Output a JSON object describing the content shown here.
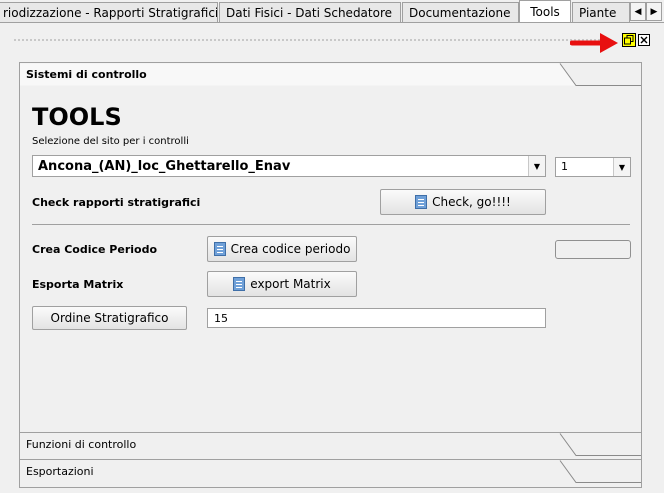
{
  "tabs": [
    {
      "label": "riodizzazione - Rapporti Stratigrafici",
      "active": false
    },
    {
      "label": "Dati Fisici - Dati Schedatore",
      "active": false
    },
    {
      "label": "Documentazione",
      "active": false
    },
    {
      "label": "Tools",
      "active": true
    },
    {
      "label": "Piante",
      "active": false
    }
  ],
  "tab_scroll": {
    "left": "◀",
    "right": "▶"
  },
  "sections": {
    "controllo": "Sistemi di controllo",
    "funzioni": "Funzioni di controllo",
    "esportazioni": "Esportazioni"
  },
  "tools": {
    "title": "TOOLS",
    "site_label": "Selezione del sito per i controlli",
    "site_value": "Ancona_(AN)_loc_Ghettarello_Enav",
    "number_value": "1",
    "check_label": "Check rapporti stratigrafici",
    "check_button": "Check, go!!!!",
    "crea_label": "Crea Codice Periodo",
    "crea_button": "Crea codice periodo",
    "esporta_label": "Esporta Matrix",
    "esporta_button": "export Matrix",
    "ordine_button": "Ordine Stratigrafico",
    "ordine_value": "15",
    "crea_field_value": ""
  },
  "colors": {
    "highlight": "#ffff00",
    "arrow": "#e81010"
  },
  "icons": {
    "float": "restore-icon",
    "close": "close-icon",
    "arrow": "red-arrow-icon",
    "button": "document-icon"
  }
}
